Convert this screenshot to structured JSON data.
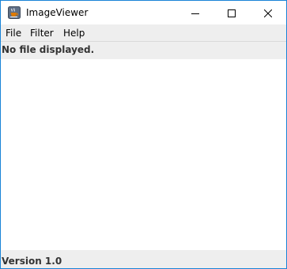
{
  "window": {
    "title": "ImageViewer",
    "border_color": "#1883d7",
    "icon": "java-cup-icon"
  },
  "controls": {
    "minimize_icon": "minimize-icon",
    "maximize_icon": "maximize-icon",
    "close_icon": "close-icon"
  },
  "menubar": {
    "items": [
      {
        "label": "File"
      },
      {
        "label": "Filter"
      },
      {
        "label": "Help"
      }
    ]
  },
  "status_top": {
    "text": "No file displayed."
  },
  "status_bottom": {
    "text": "Version 1.0"
  }
}
